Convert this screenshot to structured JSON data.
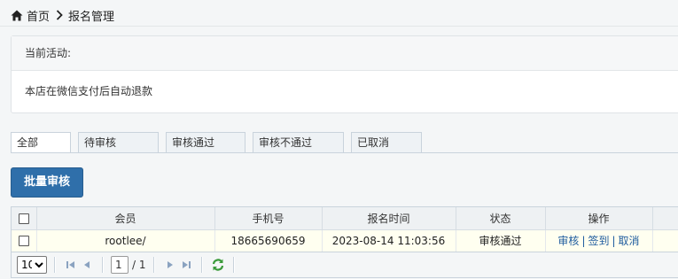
{
  "breadcrumb": {
    "home": "首页",
    "current": "报名管理"
  },
  "panel": {
    "header": "当前活动:",
    "body": "本店在微信支付后自动退款"
  },
  "tabs": [
    {
      "label": "全部",
      "active": true
    },
    {
      "label": "待审核"
    },
    {
      "label": "审核通过"
    },
    {
      "label": "审核不通过"
    },
    {
      "label": "已取消"
    }
  ],
  "batch_button": "批量审核",
  "table": {
    "columns": [
      "会员",
      "手机号",
      "报名时间",
      "状态",
      "操作"
    ],
    "rows": [
      {
        "member": "rootlee/",
        "phone": "18665690659",
        "time": "2023-08-14 11:03:56",
        "status": "审核通过",
        "actions": [
          "审核",
          "签到",
          "取消"
        ]
      }
    ]
  },
  "pager": {
    "page_size": "10",
    "page": "1",
    "total_pages": "/ 1"
  },
  "colors": {
    "primary": "#2f6faa",
    "link": "#1f5c9e",
    "row_bg": "#fffff0",
    "refresh": "#3a9a3a"
  }
}
